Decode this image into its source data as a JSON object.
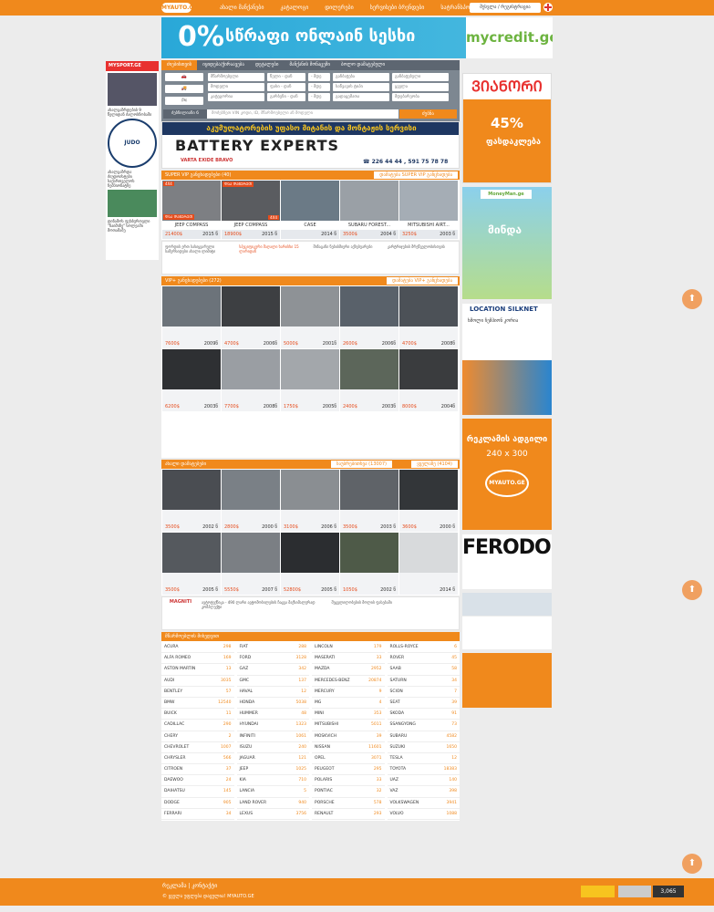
{
  "header": {
    "logo": "MYAUTO.GE",
    "nav": [
      "ახალი მანქანები",
      "კატალოგი",
      "დილერები",
      "სერვისები ბრენდები",
      "სატრანსპორტო გზეთები"
    ],
    "login": "შესვლა / რეგისტრაცია"
  },
  "banner_top": {
    "pct": "0%",
    "text": "სწრაფი ონლაინ სესხი",
    "brand": "mycredit.ge"
  },
  "left": {
    "hdr": "MYSPORT.GE",
    "t1": "ახალგაზრდების 9 წელიდან ძალოსნობაში",
    "t2": "ახალგაზრდა ძიუდოისტები საქართველოს ჩემპიონატზე",
    "t3": "დინამოს ფეხბურთელი \"ჩაიმინე\" სოლეაში მოთამაშე",
    "logo": "JUDO"
  },
  "tabs": [
    "ძიებისთვის",
    "იყიდება/ქირაავება",
    "დეტალები",
    "მანქანის მონაცემი",
    "ბოლო დამატებული"
  ],
  "search": {
    "r1": [
      "მწარმოებელი",
      "წელი - დან",
      "- მდე",
      "განბაჟება",
      "განბაჟებული"
    ],
    "r2": [
      "მოდელი",
      "ფასი - დან",
      "- მდე",
      "საწვავის ტიპი",
      "ყველა"
    ],
    "r3": [
      "კატეგორია",
      "გარბენი - დან",
      "- მდე",
      "გადაცემათა",
      "მდებარეობა"
    ],
    "label": "ძებნილიანი 6",
    "placeholder": "მოძებნეთ VIN კოდი, ID, მწარმოებელი ან მოდელი",
    "btn": "ძებნა"
  },
  "battery": {
    "t1": "აკუმულატორების უფასო მიტანის და მონტაჟის სერვისი",
    "t2": "BATTERY EXPERTS",
    "t3": "☎ 226 44 44 , 591 75 78 78",
    "t4": "VARTA EXIDE BRAVO"
  },
  "super": {
    "title": "SUPER VIP განცხადებები (40)",
    "more": "დამატება SUPER VIP განცხადება",
    "cards": [
      {
        "name": "JEEP COMPASS",
        "price": "21400$",
        "year": "2015 წ",
        "tag": "4X4",
        "tag2": "ᲓᲐᲐ ᲓᲐᲬᲔᲠᲔᲗ"
      },
      {
        "name": "JEEP COMPASS",
        "price": "18900$",
        "year": "2015 წ",
        "tag": "ᲓᲐᲐ ᲓᲐᲬᲔᲠᲔᲗ",
        "tag2": "4X4"
      },
      {
        "name": "CASE",
        "price": "",
        "year": "2014 წ",
        "tag": "",
        "tag2": ""
      },
      {
        "name": "SUBARU FOREST...",
        "price": "3500$",
        "year": "2004 წ",
        "tag": "",
        "tag2": ""
      },
      {
        "name": "MITSUBISHI AIRT...",
        "price": "3250$",
        "year": "2003 წ",
        "tag": "",
        "tag2": ""
      }
    ]
  },
  "ads1": {
    "a1": "ფორდის ერთ სასიყვარული სამერსიდესი ახალი ლიმიტი",
    "a2": "სპეციფიკური მაღალი ხარისხი 15 ლარიდან",
    "a3": "შინაგანი ნებისმიერი აქსესუარები",
    "a4": "კარტრიჯების მრეწველობისთვის"
  },
  "vip": {
    "title": "VIP+ განცხადებები (272)",
    "more": "დამატება VIP+ განცხადება",
    "cards": [
      {
        "price": "7600$",
        "year": "2009წ"
      },
      {
        "price": "4700$",
        "year": "2006წ"
      },
      {
        "price": "5000$",
        "year": "2001წ"
      },
      {
        "price": "2600$",
        "year": "2006წ"
      },
      {
        "price": "4700$",
        "year": "2008წ"
      },
      {
        "price": "6200$",
        "year": "2003წ"
      },
      {
        "price": "7700$",
        "year": "2008წ"
      },
      {
        "price": "1750$",
        "year": "2005წ"
      },
      {
        "price": "2400$",
        "year": "2003წ"
      },
      {
        "price": "8000$",
        "year": "2004წ"
      }
    ]
  },
  "recent": {
    "title": "ახალი დამატებები",
    "m1": "საუბრებითხვა (13007)",
    "m2": "ყველაზე (4104)",
    "cards": [
      {
        "price": "3500$",
        "year": "2002 წ"
      },
      {
        "price": "2800$",
        "year": "2000 წ"
      },
      {
        "price": "3100$",
        "year": "2006 წ"
      },
      {
        "price": "3500$",
        "year": "2003 წ"
      },
      {
        "price": "3600$",
        "year": "2000 წ"
      },
      {
        "price": "3500$",
        "year": "2005 წ"
      },
      {
        "price": "5550$",
        "year": "2007 წ"
      },
      {
        "price": "52800$",
        "year": "2005 წ"
      },
      {
        "price": "1050$",
        "year": "2002 წ"
      },
      {
        "price": "",
        "year": "2014 წ"
      }
    ]
  },
  "ads2": {
    "a1": "MAGNITI",
    "a2": "ავტოტექნიკა - 490 ლარი ავტომობილების ჩაცვა მაქსიმალურად კომპლექტი",
    "a3": "შეცვლილობების მოლის ფასებაში"
  },
  "brands_title": "მწარმოებლის მიხედვით",
  "brands": [
    [
      [
        "ACURA",
        "298"
      ],
      [
        "ALFA ROMEO",
        "169"
      ],
      [
        "ASTON MARTIN",
        "13"
      ],
      [
        "AUDI",
        "3035"
      ],
      [
        "BENTLEY",
        "57"
      ],
      [
        "BMW",
        "12540"
      ],
      [
        "BUICK",
        "11"
      ],
      [
        "CADILLAC",
        "290"
      ],
      [
        "CHERY",
        "2"
      ],
      [
        "CHEVROLET",
        "1007"
      ],
      [
        "CHRYSLER",
        "566"
      ],
      [
        "CITROEN",
        "37"
      ],
      [
        "DAEWOO",
        "24"
      ],
      [
        "DAIHATSU",
        "145"
      ],
      [
        "DODGE",
        "905"
      ],
      [
        "FERRARI",
        "34"
      ]
    ],
    [
      [
        "FIAT",
        "288"
      ],
      [
        "FORD",
        "3128"
      ],
      [
        "GAZ",
        "342"
      ],
      [
        "GMC",
        "137"
      ],
      [
        "HAVAL",
        "12"
      ],
      [
        "HONDA",
        "5038"
      ],
      [
        "HUMMER",
        "48"
      ],
      [
        "HYUNDAI",
        "1323"
      ],
      [
        "INFINITI",
        "1061"
      ],
      [
        "ISUZU",
        "240"
      ],
      [
        "JAGUAR",
        "121"
      ],
      [
        "JEEP",
        "1025"
      ],
      [
        "KIA",
        "710"
      ],
      [
        "LANCIA",
        "5"
      ],
      [
        "LAND ROVER",
        "940"
      ],
      [
        "LEXUS",
        "3756"
      ]
    ],
    [
      [
        "LINCOLN",
        "179"
      ],
      [
        "MASERATI",
        "33"
      ],
      [
        "MAZDA",
        "2952"
      ],
      [
        "MERCEDES-BENZ",
        "20874"
      ],
      [
        "MERCURY",
        "9"
      ],
      [
        "MG",
        "4"
      ],
      [
        "MINI",
        "353"
      ],
      [
        "MITSUBISHI",
        "5011"
      ],
      [
        "MOSKVICH",
        "39"
      ],
      [
        "NISSAN",
        "11601"
      ],
      [
        "OPEL",
        "3071"
      ],
      [
        "PEUGEOT",
        "295"
      ],
      [
        "POLARIS",
        "33"
      ],
      [
        "PONTIAC",
        "32"
      ],
      [
        "PORSCHE",
        "578"
      ],
      [
        "RENAULT",
        "293"
      ]
    ],
    [
      [
        "ROLLS-ROYCE",
        "6"
      ],
      [
        "ROVER",
        "45"
      ],
      [
        "SAAB",
        "58"
      ],
      [
        "SATURN",
        "34"
      ],
      [
        "SCION",
        "7"
      ],
      [
        "SEAT",
        "39"
      ],
      [
        "SKODA",
        "91"
      ],
      [
        "SSANGYONG",
        "73"
      ],
      [
        "SUBARU",
        "4582"
      ],
      [
        "SUZUKI",
        "1650"
      ],
      [
        "TESLA",
        "12"
      ],
      [
        "TOYOTA",
        "18383"
      ],
      [
        "UAZ",
        "140"
      ],
      [
        "VAZ",
        "398"
      ],
      [
        "VOLKSWAGEN",
        "3941"
      ],
      [
        "VOLVO",
        "1088"
      ]
    ]
  ],
  "right": {
    "tire": "ᲕᲘᲐᲜᲝᲠᲘ",
    "tire_pct": "45%",
    "tire_txt": "ფასდაკლება",
    "money": "MoneyMan.ge",
    "money_txt": "მინდა",
    "sport": "LOCATION SILKNET",
    "sport_txt": "ხმოლი ჩემპიონ კორია",
    "ad_t1": "რეკლამის ადგილი",
    "ad_t2": "240 x 300",
    "ad_logo": "MYAUTO.GE",
    "ferodo": "FERODO"
  },
  "footer": {
    "links": "რეკლამა | კონტაქტი",
    "copy": "© ყველა უფლება დაცულია! MYAUTO.GE",
    "counter": "3,065"
  }
}
